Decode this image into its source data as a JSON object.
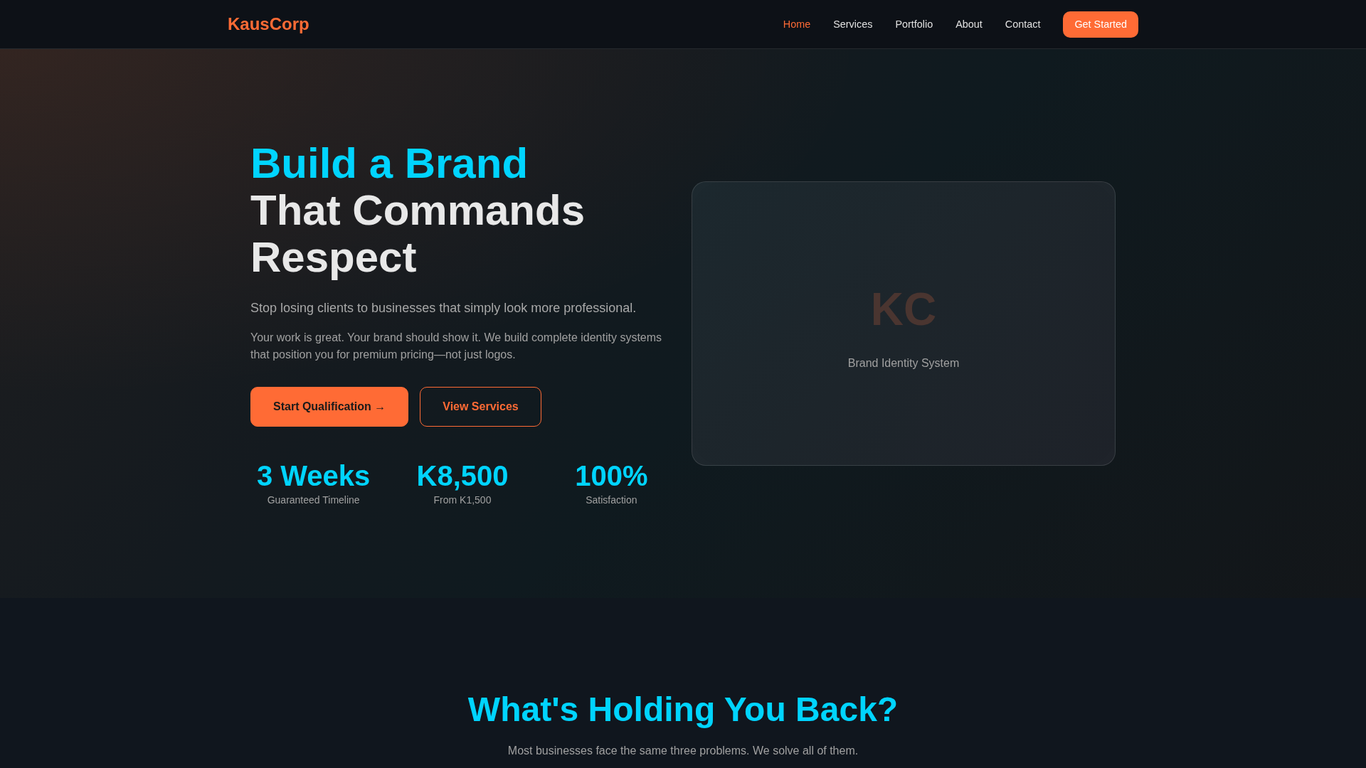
{
  "nav": {
    "logo": "KausCorp",
    "links": [
      {
        "label": "Home",
        "selected": true
      },
      {
        "label": "Services",
        "selected": false
      },
      {
        "label": "Portfolio",
        "selected": false
      },
      {
        "label": "About",
        "selected": false
      },
      {
        "label": "Contact",
        "selected": false
      }
    ],
    "cta": "Get Started"
  },
  "hero": {
    "title": {
      "highlight": "Build a Brand",
      "text": "That Commands Respect"
    },
    "subtitle": "Stop losing clients to businesses that simply look more professional.",
    "description": "Your work is great. Your brand should show it. We build complete identity systems that position you for premium pricing—not just logos.",
    "buttons": [
      {
        "label": "Start Qualification →",
        "kind": "primary"
      },
      {
        "label": "View Services",
        "kind": "outline"
      }
    ],
    "stats": [
      {
        "value": "3 Weeks",
        "label": "Guaranteed Timeline"
      },
      {
        "value": "K8,500",
        "label": "From K1,500"
      },
      {
        "value": "100%",
        "label": "Satisfaction"
      }
    ],
    "card": {
      "monogram": "KC",
      "caption": "Brand Identity System"
    }
  },
  "problems": {
    "title": "What's Holding You Back?",
    "subtitle": "Most businesses face the same three problems. We solve all of them."
  }
}
